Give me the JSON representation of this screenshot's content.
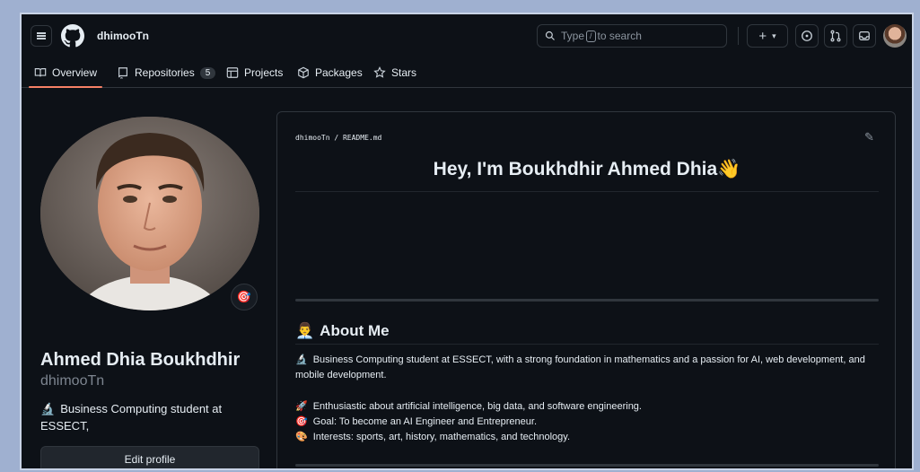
{
  "header": {
    "username": "dhimooTn",
    "search_prefix": "Type",
    "search_key": "/",
    "search_suffix": "to search",
    "plus_label": "+",
    "caret": "▾"
  },
  "tabs": [
    {
      "label": "Overview",
      "icon": "book-icon"
    },
    {
      "label": "Repositories",
      "icon": "repo-icon",
      "count": "5"
    },
    {
      "label": "Projects",
      "icon": "table-icon"
    },
    {
      "label": "Packages",
      "icon": "package-icon"
    },
    {
      "label": "Stars",
      "icon": "star-icon"
    }
  ],
  "profile": {
    "full_name": "Ahmed Dhia Boukhdhir",
    "login": "dhimooTn",
    "bio_emoji": "🔬",
    "bio": "Business Computing student at ESSECT,",
    "status_emoji": "🎯",
    "edit_label": "Edit profile"
  },
  "readme": {
    "breadcrumb": "dhimooTn / README.md",
    "title": "Hey, I'm Boukhdhir Ahmed Dhia",
    "title_emoji": "👋",
    "about_emoji": "👨‍💼",
    "about_heading": "About Me",
    "intro_emoji": "🔬",
    "intro": "Business Computing student at ESSECT, with a strong foundation in mathematics and a passion for AI, web development, and mobile development.",
    "items": [
      {
        "emoji": "🚀",
        "text": "Enthusiastic about artificial intelligence, big data, and software engineering."
      },
      {
        "emoji": "🎯",
        "text": "Goal: To become an AI Engineer and Entrepreneur."
      },
      {
        "emoji": "🎨",
        "text": "Interests: sports, art, history, mathematics, and technology."
      }
    ]
  },
  "colors": {
    "background": "#0d1117",
    "border": "#30363d",
    "accent_underline": "#f78166",
    "text": "#e6edf3",
    "muted": "#7d8590"
  }
}
